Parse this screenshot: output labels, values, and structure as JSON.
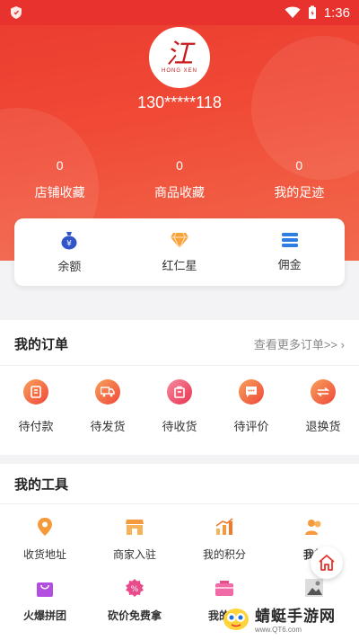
{
  "status_bar": {
    "time": "1:36"
  },
  "profile": {
    "logo_mark": "江",
    "logo_sub": "HONG XEN",
    "phone": "130*****118",
    "stats": [
      {
        "value": "0",
        "label": "店铺收藏"
      },
      {
        "value": "0",
        "label": "商品收藏"
      },
      {
        "value": "0",
        "label": "我的足迹"
      }
    ]
  },
  "wallet": [
    {
      "label": "余额",
      "icon": "money-bag-icon"
    },
    {
      "label": "红仁星",
      "icon": "diamond-icon"
    },
    {
      "label": "佣金",
      "icon": "stack-icon"
    }
  ],
  "orders": {
    "title": "我的订单",
    "more": "查看更多订单>>",
    "items": [
      {
        "label": "待付款",
        "icon": "payment-icon"
      },
      {
        "label": "待发货",
        "icon": "truck-icon"
      },
      {
        "label": "待收货",
        "icon": "package-icon"
      },
      {
        "label": "待评价",
        "icon": "comment-icon"
      },
      {
        "label": "退换货",
        "icon": "exchange-icon"
      }
    ]
  },
  "tools": {
    "title": "我的工具",
    "row1": [
      {
        "label": "收货地址",
        "icon": "location-icon"
      },
      {
        "label": "商家入驻",
        "icon": "store-icon"
      },
      {
        "label": "我的积分",
        "icon": "chart-icon"
      },
      {
        "label": "我的",
        "icon": "people-icon"
      }
    ],
    "row2": [
      {
        "label": "火爆拼团",
        "icon": "shopping-bag-icon"
      },
      {
        "label": "砍价免费拿",
        "icon": "discount-icon"
      },
      {
        "label": "我的优",
        "icon": "coupon-icon"
      },
      {
        "label": "",
        "icon": "photo-icon"
      }
    ]
  },
  "watermark": {
    "main": "蜻蜓手游网",
    "sub": "www.QT6.com"
  },
  "colors": {
    "brand_red": "#e8322d",
    "accent_orange": "#f7a33a",
    "accent_blue": "#2f7de1"
  }
}
